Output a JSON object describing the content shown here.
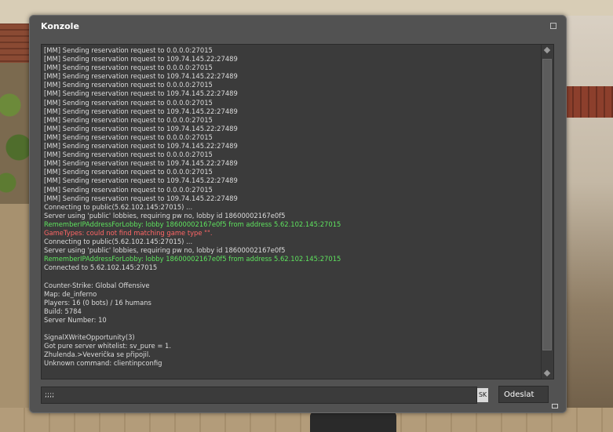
{
  "window": {
    "title": "Konzole"
  },
  "log": [
    {
      "text": "[MM] Sending reservation request to 0.0.0.0:27015",
      "tone": "normal"
    },
    {
      "text": "[MM] Sending reservation request to 109.74.145.22:27489",
      "tone": "normal"
    },
    {
      "text": "[MM] Sending reservation request to 0.0.0.0:27015",
      "tone": "normal"
    },
    {
      "text": "[MM] Sending reservation request to 109.74.145.22:27489",
      "tone": "normal"
    },
    {
      "text": "[MM] Sending reservation request to 0.0.0.0:27015",
      "tone": "normal"
    },
    {
      "text": "[MM] Sending reservation request to 109.74.145.22:27489",
      "tone": "normal"
    },
    {
      "text": "[MM] Sending reservation request to 0.0.0.0:27015",
      "tone": "normal"
    },
    {
      "text": "[MM] Sending reservation request to 109.74.145.22:27489",
      "tone": "normal"
    },
    {
      "text": "[MM] Sending reservation request to 0.0.0.0:27015",
      "tone": "normal"
    },
    {
      "text": "[MM] Sending reservation request to 109.74.145.22:27489",
      "tone": "normal"
    },
    {
      "text": "[MM] Sending reservation request to 0.0.0.0:27015",
      "tone": "normal"
    },
    {
      "text": "[MM] Sending reservation request to 109.74.145.22:27489",
      "tone": "normal"
    },
    {
      "text": "[MM] Sending reservation request to 0.0.0.0:27015",
      "tone": "normal"
    },
    {
      "text": "[MM] Sending reservation request to 109.74.145.22:27489",
      "tone": "normal"
    },
    {
      "text": "[MM] Sending reservation request to 0.0.0.0:27015",
      "tone": "normal"
    },
    {
      "text": "[MM] Sending reservation request to 109.74.145.22:27489",
      "tone": "normal"
    },
    {
      "text": "[MM] Sending reservation request to 0.0.0.0:27015",
      "tone": "normal"
    },
    {
      "text": "[MM] Sending reservation request to 109.74.145.22:27489",
      "tone": "normal"
    },
    {
      "text": "Connecting to public(5.62.102.145:27015) ...",
      "tone": "normal"
    },
    {
      "text": "Server using 'public' lobbies, requiring pw no, lobby id 18600002167e0f5",
      "tone": "normal"
    },
    {
      "text": "RememberIPAddressForLobby: lobby 18600002167e0f5 from address 5.62.102.145:27015",
      "tone": "green"
    },
    {
      "text": "GameTypes: could not find matching game type \"\".",
      "tone": "red"
    },
    {
      "text": "Connecting to public(5.62.102.145:27015) ...",
      "tone": "normal"
    },
    {
      "text": "Server using 'public' lobbies, requiring pw no, lobby id 18600002167e0f5",
      "tone": "normal"
    },
    {
      "text": "RememberIPAddressForLobby: lobby 18600002167e0f5 from address 5.62.102.145:27015",
      "tone": "green"
    },
    {
      "text": "Connected to 5.62.102.145:27015",
      "tone": "normal"
    },
    {
      "text": "",
      "tone": "normal"
    },
    {
      "text": "Counter-Strike: Global Offensive",
      "tone": "normal"
    },
    {
      "text": "Map: de_inferno",
      "tone": "normal"
    },
    {
      "text": "Players: 16 (0 bots) / 16 humans",
      "tone": "normal"
    },
    {
      "text": "Build: 5784",
      "tone": "normal"
    },
    {
      "text": "Server Number: 10",
      "tone": "normal"
    },
    {
      "text": "",
      "tone": "normal"
    },
    {
      "text": "SignalXWriteOpportunity(3)",
      "tone": "normal"
    },
    {
      "text": "Got pure server whitelist: sv_pure = 1.",
      "tone": "normal"
    },
    {
      "text": "Zhulenda.>Veverička se připojil.",
      "tone": "normal"
    },
    {
      "text": "Unknown command: clientinpconfig",
      "tone": "normal"
    }
  ],
  "input": {
    "value": ";;;;"
  },
  "language_badge": "SK",
  "submit_label": "Odeslat"
}
